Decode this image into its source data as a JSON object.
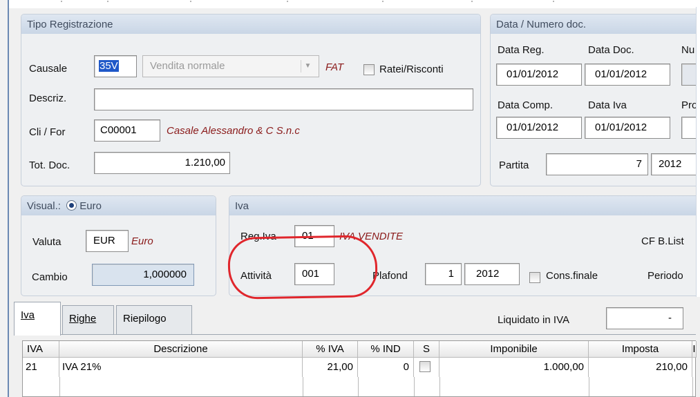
{
  "tipo_registrazione": {
    "title": "Tipo Registrazione",
    "causale_label": "Causale",
    "causale_code": "35V",
    "causale_desc": "Vendita normale",
    "doc_type": "FAT",
    "ratei_label": "Ratei/Risconti",
    "descriz_label": "Descriz.",
    "descriz_value": "",
    "cli_for_label": "Cli / For",
    "cli_for_code": "C00001",
    "cli_for_name": "Casale Alessandro & C S.n.c",
    "tot_doc_label": "Tot. Doc.",
    "tot_doc_value": "1.210,00"
  },
  "data_numero": {
    "title": "Data / Numero doc.",
    "data_reg_label": "Data Reg.",
    "data_reg": "01/01/2012",
    "data_doc_label": "Data Doc.",
    "data_doc": "01/01/2012",
    "num_label": "Nu",
    "data_comp_label": "Data Comp.",
    "data_comp": "01/01/2012",
    "data_iva_label": "Data Iva",
    "data_iva": "01/01/2012",
    "pro_label": "Pro",
    "partita_label": "Partita",
    "partita_num": "7",
    "partita_year": "2012"
  },
  "visual": {
    "title": "Visual.:",
    "radio_label": "Euro",
    "valuta_label": "Valuta",
    "valuta_code": "EUR",
    "valuta_name": "Euro",
    "cambio_label": "Cambio",
    "cambio_value": "1,000000"
  },
  "iva_group": {
    "title": "Iva",
    "reg_iva_label": "Reg.Iva",
    "reg_iva_code": "01",
    "reg_iva_name": "IVA VENDITE",
    "cf_blist_label": "CF B.List",
    "attivita_label": "Attività",
    "attivita_value": "001",
    "plafond_label": "Plafond",
    "plafond_num": "1",
    "plafond_year": "2012",
    "cons_finale_label": "Cons.finale",
    "periodo_label": "Periodo"
  },
  "tabs": [
    {
      "label": "Iva"
    },
    {
      "label": "Righe"
    },
    {
      "label": "Riepilogo"
    }
  ],
  "liquidato": {
    "label": "Liquidato in IVA",
    "value": "-"
  },
  "grid": {
    "headers": [
      "IVA",
      "Descrizione",
      "% IVA",
      "% IND",
      "S",
      "Imponibile",
      "Imposta",
      "I"
    ],
    "rows": [
      {
        "iva": "21",
        "descrizione": "IVA 21%",
        "perc_iva": "21,00",
        "perc_ind": "0",
        "imponibile": "1.000,00",
        "imposta": "210,00"
      }
    ]
  }
}
